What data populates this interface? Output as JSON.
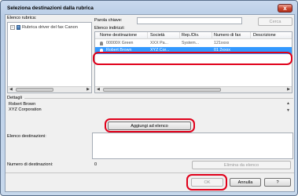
{
  "window": {
    "title": "Seleziona destinazioni dalla rubrica",
    "close_glyph": "x"
  },
  "address_book_list": {
    "label": "Elenco rubrica:",
    "item": "Rubrica driver del fax Canon",
    "collapse_glyph": "−"
  },
  "keyword": {
    "label": "Parola chiave:",
    "value": "",
    "search_button": "Cerca"
  },
  "address_list": {
    "label": "Elenco indirizzi:",
    "columns": [
      "Nome destinazione",
      "Società",
      "Rep./Div.",
      "Numero di fax",
      "Descrizione"
    ],
    "rows": [
      {
        "name": "00000X Green",
        "company": "XXX Pa...",
        "dept": "System...",
        "fax": "121xxxx",
        "desc": "",
        "selected": false
      },
      {
        "name": "Robert Brown",
        "company": "XYZ Cor...",
        "dept": "",
        "fax": "01 2xxxx",
        "desc": "",
        "selected": true
      }
    ]
  },
  "details": {
    "label": "Dettagli",
    "line1": "Robert Brown",
    "line2": "XYZ Corporation"
  },
  "add_button": "Aggiungi ad elenco",
  "destinations": {
    "label": "Elenco destinazioni:",
    "count_label": "Numero di destinazioni:",
    "count_value": "0",
    "remove_button": "Elimina da elenco"
  },
  "footer": {
    "ok": "OK",
    "cancel": "Annulla",
    "help": "?"
  },
  "icons": {
    "close": "close-icon",
    "contact": "person-icon",
    "book": "book-icon"
  },
  "colors": {
    "selection": "#3399ff",
    "highlight": "#e0001a"
  }
}
